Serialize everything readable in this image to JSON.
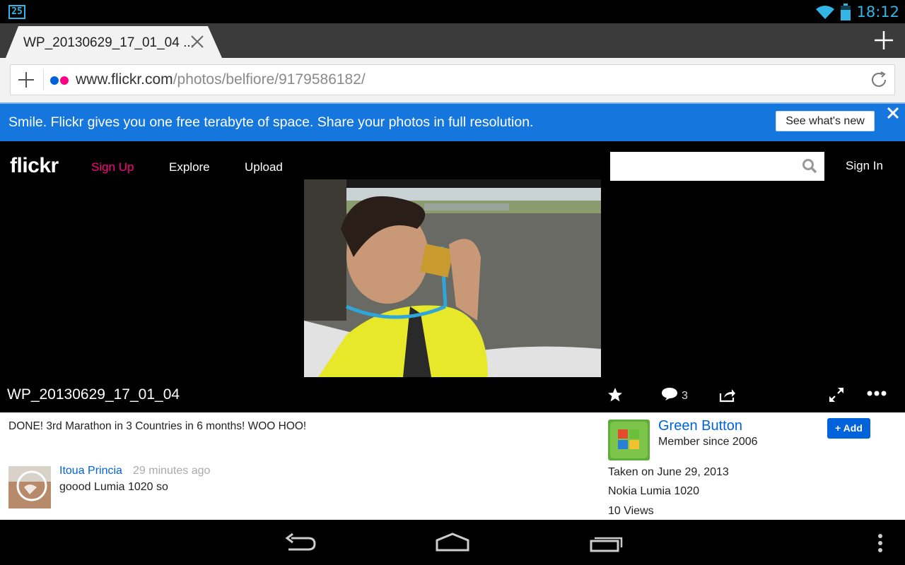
{
  "status_bar": {
    "notification_badge": "25",
    "time": "18:12"
  },
  "browser": {
    "tab_title": "WP_20130629_17_01_04 ...",
    "url_host": "www.flickr.com",
    "url_path": "/photos/belfiore/9179586182/"
  },
  "banner": {
    "text": "Smile. Flickr gives you one free terabyte of space. Share your photos in full resolution.",
    "button_label": "See what's new"
  },
  "header": {
    "logo": "flickr",
    "nav": {
      "signup": "Sign Up",
      "explore": "Explore",
      "upload": "Upload"
    },
    "sign_in": "Sign In"
  },
  "photo": {
    "title": "WP_20130629_17_01_04",
    "comment_count": "3",
    "description": "DONE! 3rd Marathon in 3 Countries in 6 months! WOO HOO!"
  },
  "comment": {
    "author": "Itoua Princia",
    "time": "29 minutes ago",
    "text": "goood Lumia 1020 so"
  },
  "owner": {
    "name": "Green Button",
    "member_since": "Member since 2006",
    "add_label": "+ Add"
  },
  "meta": {
    "taken": "Taken on June 29, 2013",
    "camera": "Nokia Lumia 1020",
    "views": "10 Views"
  },
  "colors": {
    "accent_blue": "#0063dc",
    "flickr_pink": "#ff0084",
    "banner_blue": "#1577dd",
    "android_holo": "#33b5e5"
  }
}
